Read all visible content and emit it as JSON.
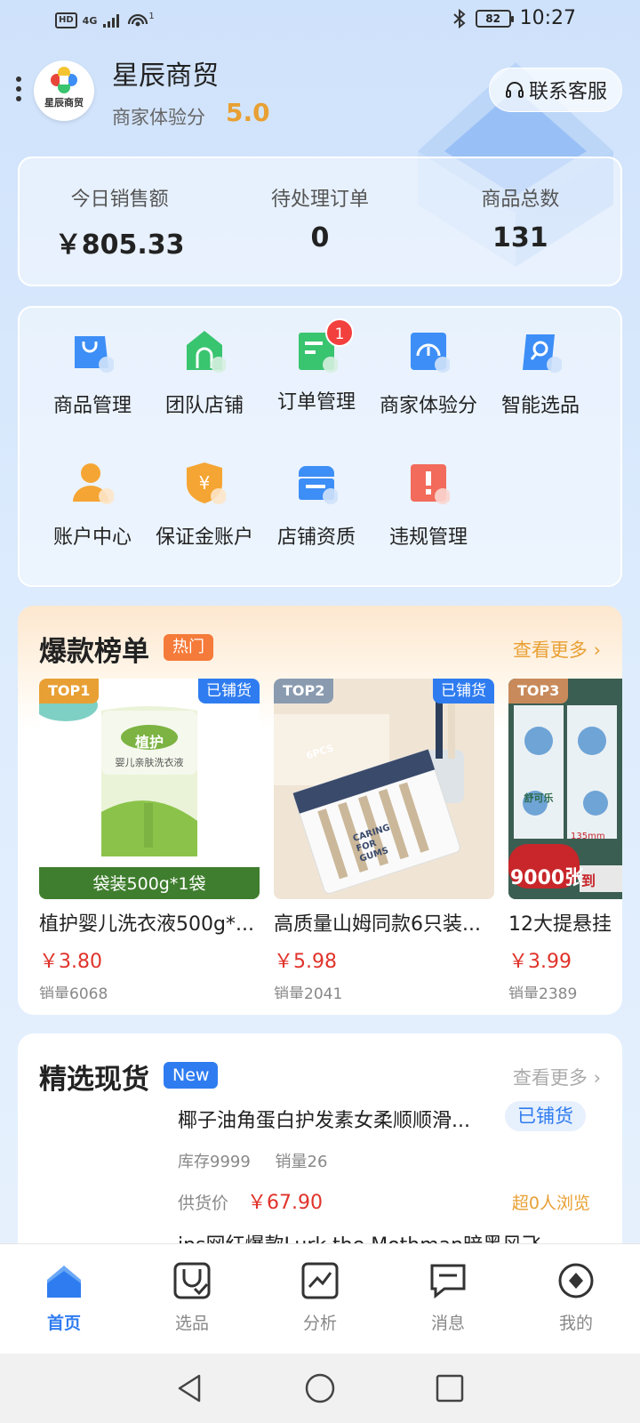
{
  "status_bar": {
    "network": "4G",
    "signal_count": "1",
    "battery": "82",
    "time": "10:27"
  },
  "header": {
    "shop_name": "星辰商贸",
    "avatar_text": "星辰商贸",
    "score_label": "商家体验分",
    "score_value": "5.0",
    "service_label": "联系客服"
  },
  "stats": [
    {
      "label": "今日销售额",
      "value": "￥805.33"
    },
    {
      "label": "待处理订单",
      "value": "0"
    },
    {
      "label": "商品总数",
      "value": "131"
    }
  ],
  "menu": {
    "items": [
      {
        "label": "商品管理",
        "icon": "shopping-bag-icon",
        "color": "#3d8ef6"
      },
      {
        "label": "团队店铺",
        "icon": "store-icon",
        "color": "#39c46f"
      },
      {
        "label": "订单管理",
        "icon": "order-icon",
        "color": "#39c46f",
        "badge": "1"
      },
      {
        "label": "商家体验分",
        "icon": "gauge-icon",
        "color": "#3d8ef6"
      },
      {
        "label": "智能选品",
        "icon": "search-icon",
        "color": "#3d8ef6"
      },
      {
        "label": "账户中心",
        "icon": "user-icon",
        "color": "#f5a533"
      },
      {
        "label": "保证金账户",
        "icon": "deposit-shield-icon",
        "color": "#f5a533"
      },
      {
        "label": "店铺资质",
        "icon": "qualification-icon",
        "color": "#3d8ef6"
      },
      {
        "label": "违规管理",
        "icon": "warning-icon",
        "color": "#f26b5b"
      }
    ]
  },
  "hot": {
    "title": "爆款榜单",
    "tag": "热门",
    "more": "查看更多",
    "products": [
      {
        "rank": "TOP1",
        "listed": "已铺货",
        "name": "植护婴儿洗衣液500g*...",
        "price": "￥3.80",
        "sales": "销量6068",
        "img_caption": "袋装500g*1袋",
        "img_brand": "植护",
        "img_desc": "婴儿亲肤洗衣液"
      },
      {
        "rank": "TOP2",
        "listed": "已铺货",
        "name": "高质量山姆同款6只装...",
        "price": "￥5.98",
        "sales": "销量2041",
        "img_pack": "6PCS",
        "img_desc": "CARING FOR GUMS"
      },
      {
        "rank": "TOP3",
        "listed": "",
        "name": "12大提悬挂",
        "price": "￥3.99",
        "sales": "销量2389",
        "img_count": "9000张",
        "img_brand": "舒可乐",
        "img_size": "135mm",
        "img_extra": "到"
      }
    ]
  },
  "stock": {
    "title": "精选现货",
    "tag": "New",
    "more": "查看更多",
    "item": {
      "name": "椰子油角蛋白护发素女柔顺顺滑...",
      "listed": "已铺货",
      "stock": "库存9999",
      "sales": "销量26",
      "price_label": "供货价",
      "price": "￥67.90",
      "views": "超0人浏览"
    },
    "next_item_name": "ins网红爆款Lurk the Mothman暗黑风飞"
  },
  "bottom_nav": [
    {
      "label": "首页",
      "icon": "home-icon",
      "active": true
    },
    {
      "label": "选品",
      "icon": "select-product-icon"
    },
    {
      "label": "分析",
      "icon": "chart-icon"
    },
    {
      "label": "消息",
      "icon": "message-icon"
    },
    {
      "label": "我的",
      "icon": "profile-icon"
    }
  ],
  "colors": {
    "accent": "#2f7cf0",
    "price": "#e0332b",
    "score": "#e8a034",
    "hot_tag": "#f57b3a"
  }
}
